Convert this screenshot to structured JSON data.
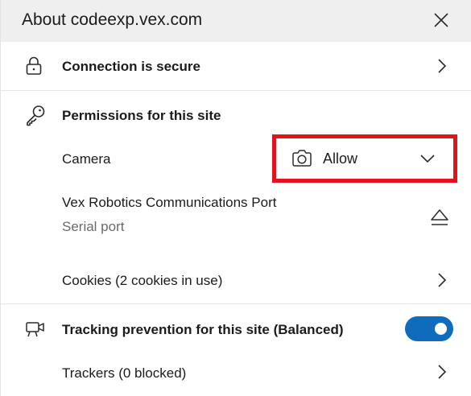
{
  "header": {
    "title": "About codeexp.vex.com"
  },
  "connection": {
    "label": "Connection is secure"
  },
  "permissions": {
    "heading": "Permissions for this site",
    "camera": {
      "label": "Camera",
      "selected": "Allow"
    },
    "serial": {
      "label": "Vex Robotics Communications Port",
      "sublabel": "Serial port"
    },
    "cookies": {
      "label": "Cookies (2 cookies in use)"
    }
  },
  "tracking": {
    "label": "Tracking prevention for this site (Balanced)",
    "enabled": true,
    "trackers_label": "Trackers (0 blocked)"
  },
  "colors": {
    "header_bg": "#efefef",
    "highlight": "#e1141e",
    "toggle_on": "#0f6cbd"
  }
}
